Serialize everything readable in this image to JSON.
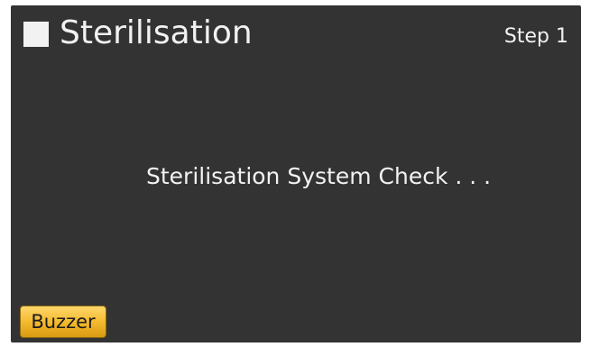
{
  "header": {
    "title": "Sterilisation",
    "step": "Step 1"
  },
  "main": {
    "message": "Sterilisation System Check . . ."
  },
  "footer": {
    "buzzer_label": "Buzzer"
  },
  "colors": {
    "background": "#333333",
    "text": "#f2f2f2",
    "button": "#f2b72a"
  },
  "icons": {
    "header": "square-icon"
  }
}
